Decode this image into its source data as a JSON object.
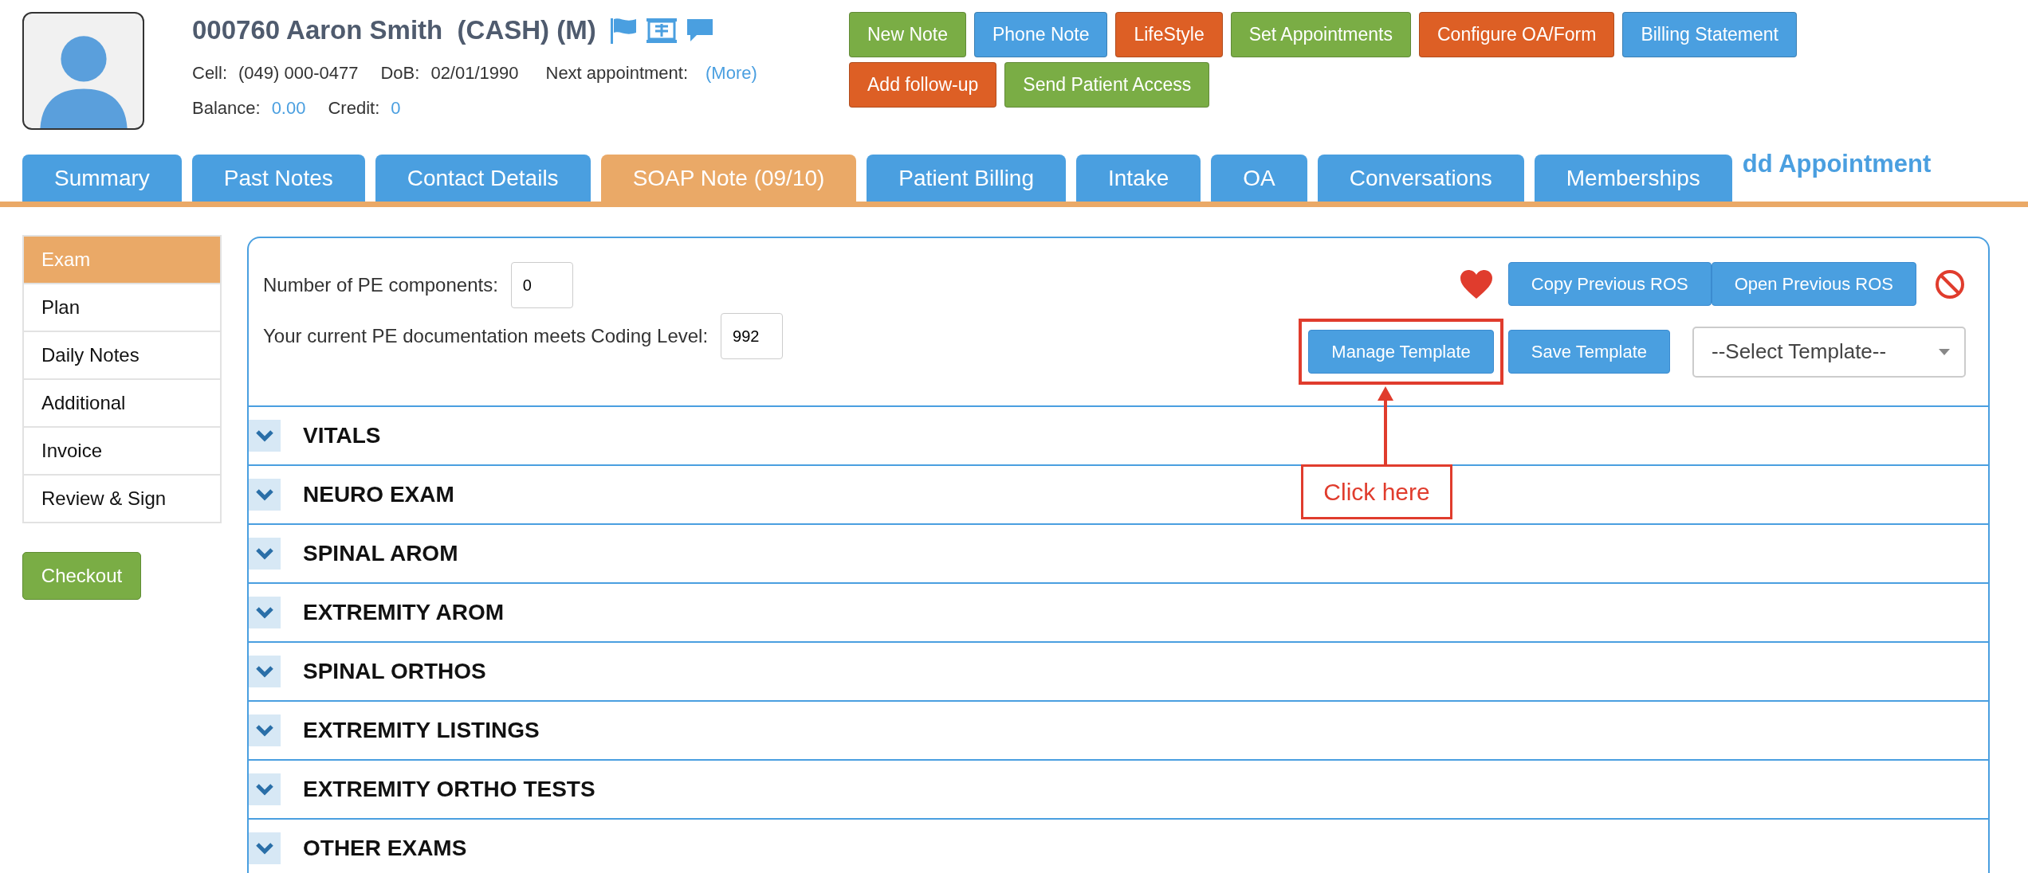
{
  "patient": {
    "title": "000760 Aaron Smith  (CASH) (M)",
    "cell_label": "Cell:",
    "cell": "(049) 000-0477",
    "dob_label": "DoB:",
    "dob": "02/01/1990",
    "next_label": "Next appointment:",
    "next_link": "(More)",
    "balance_label": "Balance:",
    "balance": "0.00",
    "credit_label": "Credit:",
    "credit": "0"
  },
  "actions": [
    {
      "label": "New Note",
      "color": "#7aad45"
    },
    {
      "label": "Phone Note",
      "color": "#4a9fe0"
    },
    {
      "label": "LifeStyle",
      "color": "#dd5f25"
    },
    {
      "label": "Set Appointments",
      "color": "#7aad45"
    },
    {
      "label": "Configure OA/Form",
      "color": "#dd5f25"
    },
    {
      "label": "Billing Statement",
      "color": "#4a9fe0"
    },
    {
      "label": "Add follow-up",
      "color": "#dd5f25"
    },
    {
      "label": "Send Patient Access",
      "color": "#7aad45"
    }
  ],
  "tabs": [
    {
      "label": "Summary",
      "selected": false
    },
    {
      "label": "Past Notes",
      "selected": false
    },
    {
      "label": "Contact Details",
      "selected": false
    },
    {
      "label": "SOAP Note (09/10)",
      "selected": true
    },
    {
      "label": "Patient Billing",
      "selected": false
    },
    {
      "label": "Intake",
      "selected": false
    },
    {
      "label": "OA",
      "selected": false
    },
    {
      "label": "Conversations",
      "selected": false
    },
    {
      "label": "Memberships",
      "selected": false
    }
  ],
  "add_appointment_link": "dd Appointment",
  "sidebar": {
    "items": [
      {
        "label": "Exam",
        "selected": true
      },
      {
        "label": "Plan",
        "selected": false
      },
      {
        "label": "Daily Notes",
        "selected": false
      },
      {
        "label": "Additional",
        "selected": false
      },
      {
        "label": "Invoice",
        "selected": false
      },
      {
        "label": "Review & Sign",
        "selected": false
      }
    ],
    "checkout": "Checkout"
  },
  "pe": {
    "components_label": "Number of PE components:",
    "components_value": "0",
    "coding_label": "Your current PE documentation meets Coding Level:",
    "coding_value": "992"
  },
  "toolbar": {
    "copy": "Copy Previous ROS",
    "open": "Open Previous ROS",
    "manage": "Manage Template",
    "save": "Save Template",
    "select_placeholder": "--Select Template--"
  },
  "sections": [
    "VITALS",
    "NEURO EXAM",
    "SPINAL AROM",
    "EXTREMITY AROM",
    "SPINAL ORTHOS",
    "EXTREMITY LISTINGS",
    "EXTREMITY ORTHO TESTS",
    "OTHER EXAMS"
  ],
  "annotation": {
    "callout": "Click here"
  }
}
